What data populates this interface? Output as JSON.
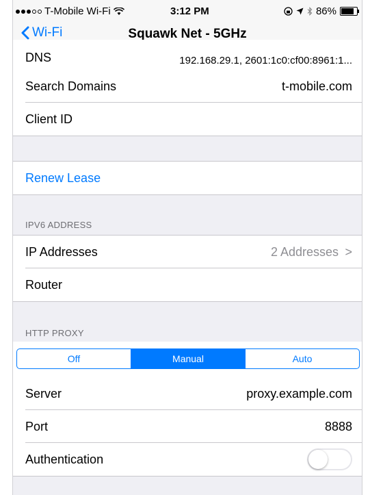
{
  "status_bar": {
    "carrier": "T-Mobile Wi-Fi",
    "time": "3:12 PM",
    "battery": "86%"
  },
  "nav": {
    "back_label": "Wi-Fi",
    "title": "Squawk Net - 5GHz"
  },
  "rows": {
    "dns": {
      "label": "DNS",
      "value": "192.168.29.1, 2601:1c0:cf00:8961:1..."
    },
    "search_domains": {
      "label": "Search Domains",
      "value": "t-mobile.com"
    },
    "client_id": {
      "label": "Client ID",
      "value": ""
    },
    "renew_lease": {
      "label": "Renew Lease"
    }
  },
  "ipv6": {
    "header": "IPV6 ADDRESS",
    "ip_addresses": {
      "label": "IP Addresses",
      "value": "2 Addresses",
      "chevron": ">"
    },
    "router": {
      "label": "Router",
      "value": ""
    }
  },
  "http_proxy": {
    "header": "HTTP PROXY",
    "segments": [
      "Off",
      "Manual",
      "Auto"
    ],
    "selected": "Manual",
    "server": {
      "label": "Server",
      "value": "proxy.example.com"
    },
    "port": {
      "label": "Port",
      "value": "8888"
    },
    "authentication": {
      "label": "Authentication",
      "enabled": false
    }
  },
  "colors": {
    "accent": "#007aff",
    "background": "#efeff4",
    "separator": "#c8c7cc",
    "secondary_text": "#8e8e93"
  }
}
